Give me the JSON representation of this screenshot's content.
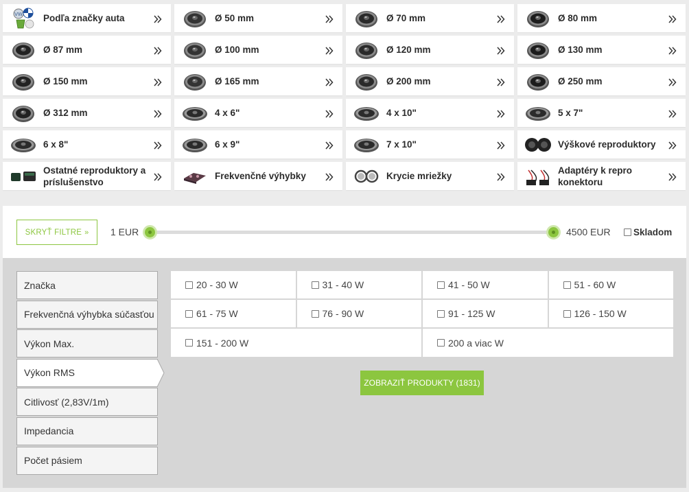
{
  "categories": [
    {
      "label": "Podľa značky auta",
      "icon": "car-brand-logos-icon"
    },
    {
      "label": "Ø 50 mm",
      "icon": "speaker-icon"
    },
    {
      "label": "Ø 70 mm",
      "icon": "speaker-icon"
    },
    {
      "label": "Ø 80 mm",
      "icon": "speaker-icon"
    },
    {
      "label": "Ø 87 mm",
      "icon": "speaker-icon"
    },
    {
      "label": "Ø 100 mm",
      "icon": "speaker-icon"
    },
    {
      "label": "Ø 120 mm",
      "icon": "speaker-icon"
    },
    {
      "label": "Ø 130 mm",
      "icon": "speaker-icon"
    },
    {
      "label": "Ø 150 mm",
      "icon": "speaker-icon"
    },
    {
      "label": "Ø 165 mm",
      "icon": "speaker-icon"
    },
    {
      "label": "Ø 200 mm",
      "icon": "speaker-icon"
    },
    {
      "label": "Ø 250 mm",
      "icon": "speaker-icon"
    },
    {
      "label": "Ø 312 mm",
      "icon": "speaker-icon"
    },
    {
      "label": "4 x 6\"",
      "icon": "oval-speaker-icon"
    },
    {
      "label": "4 x 10\"",
      "icon": "oval-speaker-icon"
    },
    {
      "label": "5 x 7\"",
      "icon": "oval-speaker-icon"
    },
    {
      "label": "6 x 8\"",
      "icon": "oval-speaker-icon"
    },
    {
      "label": "6 x 9\"",
      "icon": "oval-speaker-icon"
    },
    {
      "label": "7 x 10\"",
      "icon": "oval-speaker-icon"
    },
    {
      "label": "Výškové reproduktory",
      "icon": "tweeter-icon"
    },
    {
      "label": "Ostatné reproduktory a príslušenstvo",
      "icon": "accessories-icon"
    },
    {
      "label": "Frekvenčné výhybky",
      "icon": "crossover-icon"
    },
    {
      "label": "Krycie mriežky",
      "icon": "grille-icon"
    },
    {
      "label": "Adaptéry k repro konektoru",
      "icon": "adapter-cable-icon"
    }
  ],
  "filter_bar": {
    "hide_filters_label": "SKRYŤ FILTRE",
    "price_min": "1 EUR",
    "price_max": "4500 EUR",
    "price_range_selected": [
      0,
      1
    ],
    "in_stock_label": "Skladom",
    "in_stock_checked": false
  },
  "filter_tabs": [
    {
      "label": "Značka",
      "active": false
    },
    {
      "label": "Frekvenčná výhybka súčasťou",
      "active": false
    },
    {
      "label": "Výkon Max.",
      "active": false
    },
    {
      "label": "Výkon RMS",
      "active": true
    },
    {
      "label": "Citlivosť (2,83V/1m)",
      "active": false
    },
    {
      "label": "Impedancia",
      "active": false
    },
    {
      "label": "Počet pásiem",
      "active": false
    }
  ],
  "rms_options": [
    [
      "20 - 30 W",
      "31 - 40 W",
      "41 - 50 W",
      "51 - 60 W"
    ],
    [
      "61 - 75 W",
      "76 - 90 W",
      "91 - 125 W",
      "126 - 150 W"
    ],
    [
      "151 - 200 W",
      "200 a viac W"
    ]
  ],
  "show_products_label": "ZOBRAZIŤ PRODUKTY (1831)",
  "colors": {
    "accent": "#8cc63f",
    "panel": "#d6d6d6",
    "background": "#ececec"
  }
}
